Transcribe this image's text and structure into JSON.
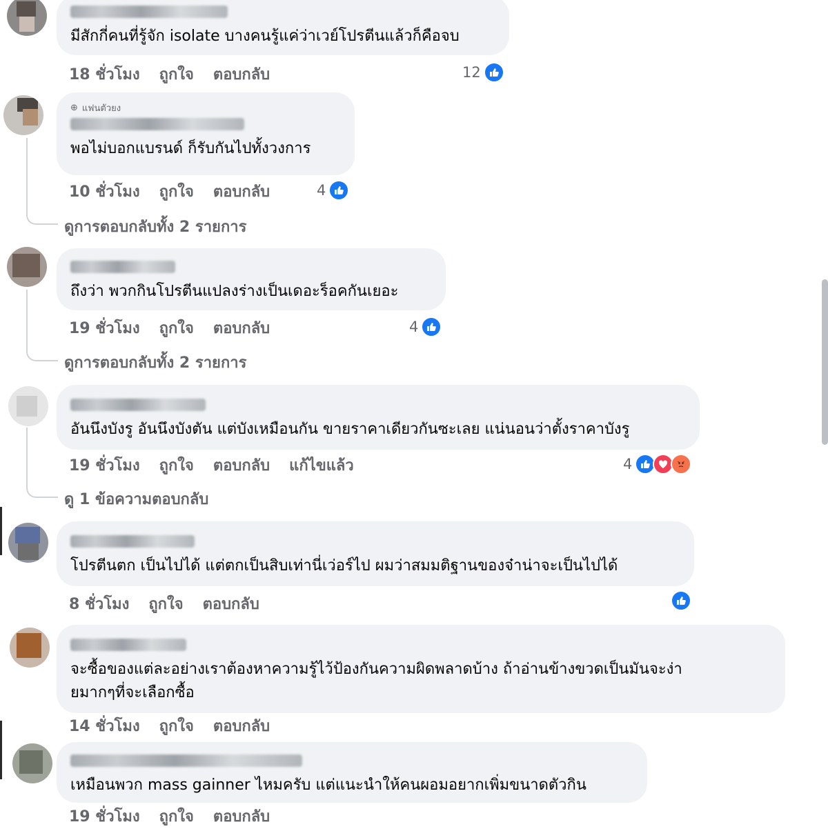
{
  "comments": [
    {
      "text": "มีสักกี่คนที่รู้จัก isolate บางคนรู้แค่ว่าเวย์โปรตีนแล้วก็คือจบ",
      "time": "18 ชั่วโมง",
      "like": "ถูกใจ",
      "reply": "ตอบกลับ",
      "reaction_count": "12"
    },
    {
      "badge": "แฟนตัวยง",
      "text": "พอไม่บอกแบรนด์ ก็รับกันไปทั้งวงการ",
      "time": "10 ชั่วโมง",
      "like": "ถูกใจ",
      "reply": "ตอบกลับ",
      "reaction_count": "4",
      "view_replies": "ดูการตอบกลับทั้ง 2 รายการ"
    },
    {
      "text": "ถึงว่า พวกกินโปรตีนแปลงร่างเป็นเดอะร็อคกันเยอะ",
      "time": "19 ชั่วโมง",
      "like": "ถูกใจ",
      "reply": "ตอบกลับ",
      "reaction_count": "4",
      "view_replies": "ดูการตอบกลับทั้ง 2 รายการ"
    },
    {
      "text": "อันนึงบังรู อันนึงบังตัน แต่บังเหมือนกัน ขายราคาเดียวกันซะเลย แน่นอนว่าตั้งราคาบังรู",
      "time": "19 ชั่วโมง",
      "like": "ถูกใจ",
      "reply": "ตอบกลับ",
      "edited": "แก้ไขแล้ว",
      "reaction_count": "4",
      "view_replies": "ดู 1 ข้อความตอบกลับ"
    },
    {
      "text": "โปรตีนตก เป็นไปได้ แต่ตกเป็นสิบเท่านี่เว่อร์ไป ผมว่าสมมติฐานของจ๋าน่าจะเป็นไปได้",
      "time": "8 ชั่วโมง",
      "like": "ถูกใจ",
      "reply": "ตอบกลับ"
    },
    {
      "text": "จะซื้อของแต่ละอย่างเราต้องหาความรู้ไว้ป้องกันความผิดพลาดบ้าง ถ้าอ่านข้างขวดเป็นมันจะง่า\nยมากๆที่จะเลือกซื้อ",
      "time": "14 ชั่วโมง",
      "like": "ถูกใจ",
      "reply": "ตอบกลับ"
    },
    {
      "text": "เหมือนพวก mass gainner ไหมครับ แต่แนะนำให้คนผอมอยากเพิ่มขนาดตัวกิน",
      "time": "19 ชั่วโมง",
      "like": "ถูกใจ",
      "reply": "ตอบกลับ"
    }
  ],
  "colors": {
    "bubble": "#f0f2f5",
    "meta": "#65676b",
    "like_blue": "#1877f2",
    "love_red": "#f33e58",
    "angry_orange": "#f7714c"
  },
  "icons": [
    "like-icon",
    "love-icon",
    "angry-icon",
    "globe-icon"
  ]
}
